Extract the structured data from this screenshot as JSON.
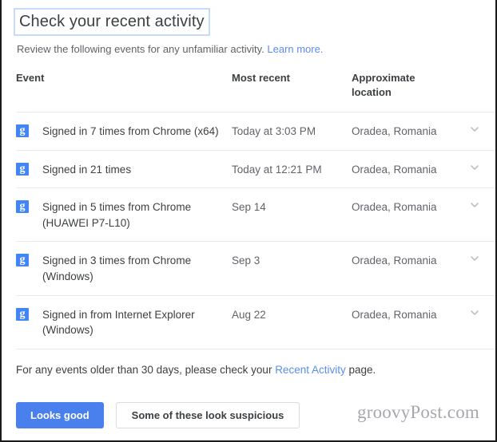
{
  "header": {
    "title": "Check your recent activity",
    "subtitle_text": "Review the following events for any unfamiliar activity.",
    "subtitle_link": "Learn more."
  },
  "table": {
    "columns": {
      "event": "Event",
      "most_recent": "Most recent",
      "approximate_location_line1": "Approximate",
      "approximate_location_line2": "location"
    },
    "rows": [
      {
        "icon": "google-g-icon",
        "event": "Signed in 7 times from Chrome (x64)",
        "most_recent": "Today at 3:03 PM",
        "location": "Oradea, Romania",
        "expander": "chevron-down-icon"
      },
      {
        "icon": "google-g-icon",
        "event": "Signed in 21 times",
        "most_recent": "Today at 12:21 PM",
        "location": "Oradea, Romania",
        "expander": "chevron-down-icon"
      },
      {
        "icon": "google-g-icon",
        "event": "Signed in 5 times from Chrome (HUAWEI P7-L10)",
        "most_recent": "Sep 14",
        "location": "Oradea, Romania",
        "expander": "chevron-down-icon"
      },
      {
        "icon": "google-g-icon",
        "event": "Signed in 3 times from Chrome (Windows)",
        "most_recent": "Sep 3",
        "location": "Oradea, Romania",
        "expander": "chevron-down-icon"
      },
      {
        "icon": "google-g-icon",
        "event": "Signed in from Internet Explorer (Windows)",
        "most_recent": "Aug 22",
        "location": "Oradea, Romania",
        "expander": "chevron-down-icon"
      }
    ]
  },
  "footer": {
    "note_before": "For any events older than 30 days, please check your ",
    "note_link": "Recent Activity",
    "note_after": " page.",
    "primary_button": "Looks good",
    "secondary_button": "Some of these look suspicious"
  },
  "watermark": "groovyPost.com",
  "colors": {
    "accent_blue": "#4285f4",
    "button_blue": "#4a80ee",
    "link_blue": "#5b8def",
    "text_primary": "#3c4043",
    "text_secondary": "#5f6368",
    "divider": "#e8eaed",
    "focus_ring": "#c6dafc"
  }
}
